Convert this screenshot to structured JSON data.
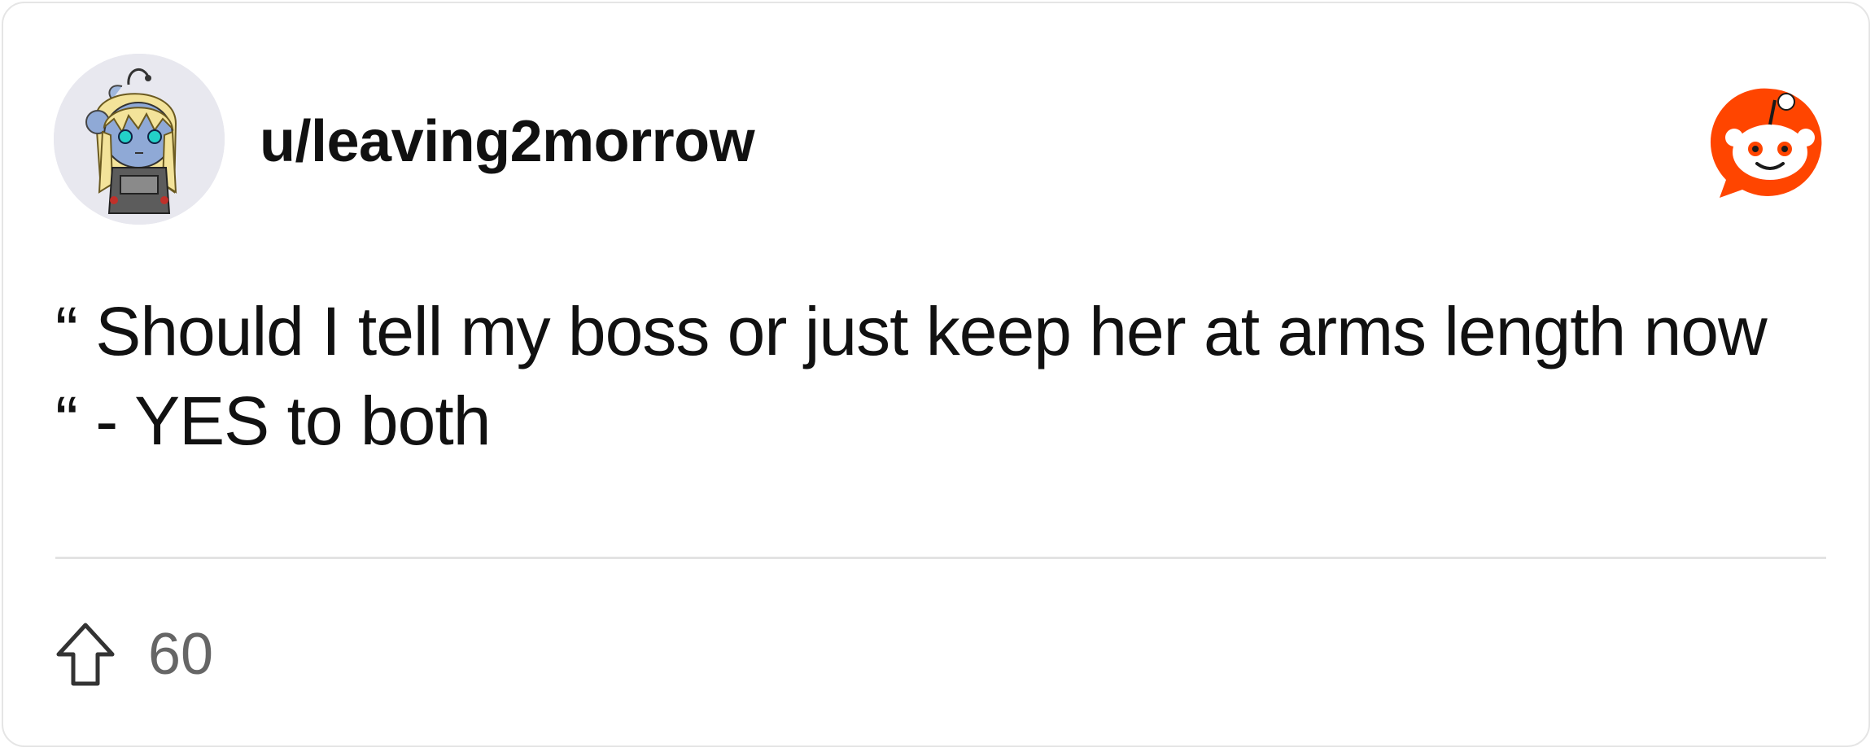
{
  "post": {
    "username": "u/leaving2morrow",
    "body": "“ Should I tell my boss or just keep her at arms length now “ - YES to both",
    "upvotes": "60"
  },
  "icons": {
    "avatar": "snoo-avatar-icon",
    "brand": "reddit-logo-icon",
    "upvote": "upvote-arrow-icon"
  },
  "colors": {
    "brand_orange": "#ff4500",
    "text_primary": "#111111",
    "text_secondary": "#666666",
    "divider": "#e3e3e3"
  }
}
